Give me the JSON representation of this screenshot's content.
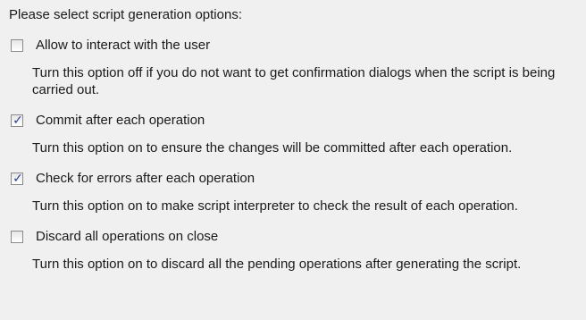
{
  "intro": "Please select script generation options:",
  "options": [
    {
      "label": "Allow to interact with the user",
      "checked": false,
      "description": "Turn this option off if you do not want to get confirmation dialogs when the script is being carried out."
    },
    {
      "label": "Commit after each operation",
      "checked": true,
      "description": "Turn this option on to ensure the changes will be committed after each operation."
    },
    {
      "label": "Check for errors after each operation",
      "checked": true,
      "description": "Turn this option on to make script interpreter to check the result of each operation."
    },
    {
      "label": "Discard all operations on close",
      "checked": false,
      "description": "Turn this option on to discard all the pending operations after generating the script."
    }
  ],
  "check_glyph": "✓",
  "colors": {
    "background": "#f0f0f0",
    "text": "#1a1a1a",
    "check_mark": "#2b3f8c",
    "checkbox_border": "#8a8a8a"
  }
}
